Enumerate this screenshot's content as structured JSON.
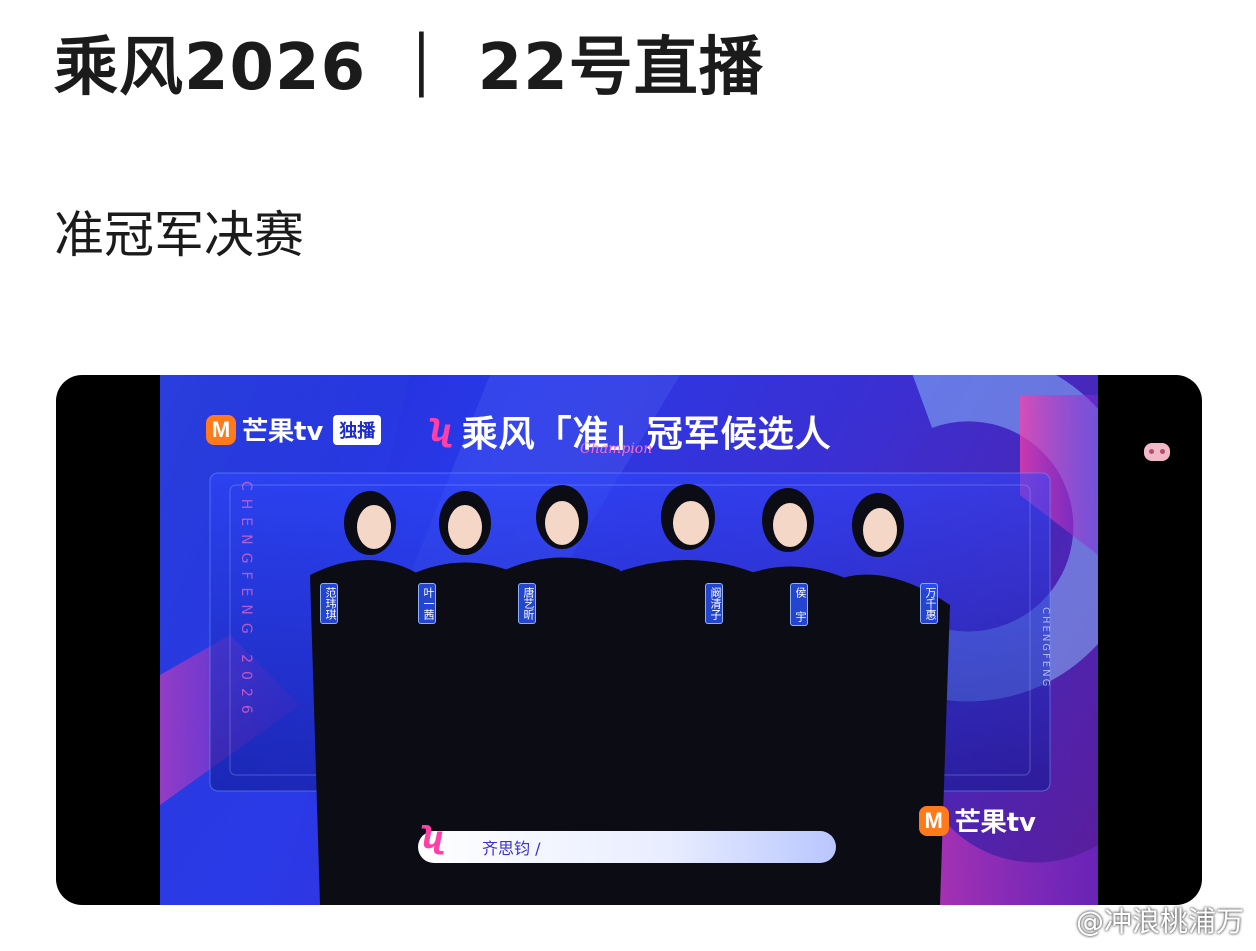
{
  "post": {
    "title": "乘风2026 ｜ 22号直播",
    "subtitle": "准冠军决赛"
  },
  "video": {
    "platform_logo": "芒果tv",
    "exclusive_badge": "独播",
    "promo_title": "乘风「准」冠军候选人",
    "promo_subtitle": "Champion",
    "vertical_deco_left": "CHENGFENG 2026",
    "vertical_deco_right": "CHENGFENG",
    "contestants": [
      {
        "name": "范玮琪"
      },
      {
        "name": "叶一茜"
      },
      {
        "name": "唐艺昕"
      },
      {
        "name": "阚清子"
      },
      {
        "name": "侯  宇"
      },
      {
        "name": "万千惠"
      }
    ],
    "lower_third_name": "齐思钧  /",
    "watermark_logo": "芒果tv",
    "colors": {
      "bg_blue": "#1e2bd0",
      "accent_pink": "#ff3fa8",
      "mango_orange": "#ff7a1a"
    }
  },
  "watermark": {
    "text": "@冲浪桃浦万",
    "icon": "weibo-icon"
  }
}
